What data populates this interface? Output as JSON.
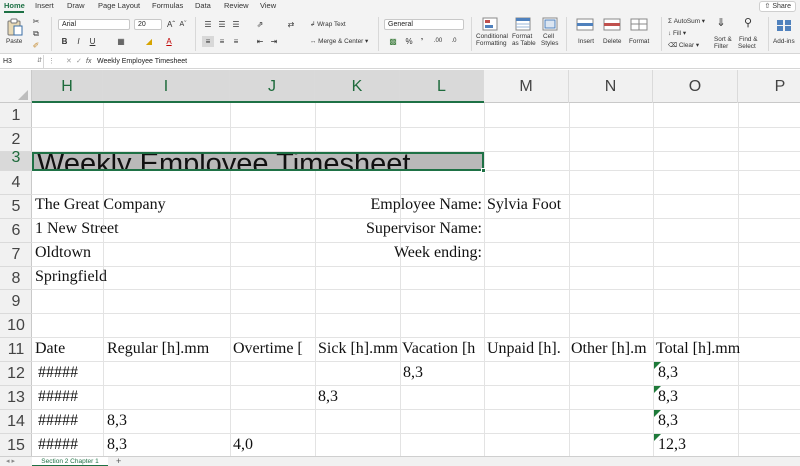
{
  "ribbon_tabs": [
    "Home",
    "Insert",
    "Draw",
    "Page Layout",
    "Formulas",
    "Data",
    "Review",
    "View"
  ],
  "share_label": "Share",
  "ribbon": {
    "paste_label": "Paste",
    "font_name": "Arial",
    "font_size": "20",
    "bold": "B",
    "italic": "I",
    "underline": "U",
    "wrap_text": "Wrap Text",
    "merge_center": "Merge & Center",
    "number_format": "General",
    "percent": "%",
    "comma": "’",
    "conditional_formatting": [
      "Conditional",
      "Formatting"
    ],
    "format_as_table": [
      "Format",
      "as Table"
    ],
    "cell_styles": [
      "Cell",
      "Styles"
    ],
    "insert": "Insert",
    "delete": "Delete",
    "format": "Format",
    "autosum": "AutoSum",
    "fill": "Fill",
    "clear": "Clear",
    "sort_filter": [
      "Sort &",
      "Filter"
    ],
    "find_select": [
      "Find &",
      "Select"
    ],
    "add_ins": "Add-ins"
  },
  "formula_bar": {
    "cell_ref": "H3",
    "fx": "fx",
    "content": "Weekly Employee Timesheet"
  },
  "columns": [
    "H",
    "I",
    "J",
    "K",
    "L",
    "M",
    "N",
    "O",
    "P"
  ],
  "rows": [
    "1",
    "2",
    "3",
    "4",
    "5",
    "6",
    "7",
    "8",
    "9",
    "10",
    "11",
    "12",
    "13",
    "14",
    "15"
  ],
  "sheet": {
    "title": "Weekly Employee Timesheet",
    "company": [
      "The Great Company",
      "1 New Street",
      "Oldtown",
      "Springfield"
    ],
    "labels": {
      "employee_name": "Employee Name:",
      "supervisor_name": "Supervisor Name:",
      "week_ending": "Week ending:"
    },
    "employee_name_value": "Sylvia Foot",
    "headers": [
      "Date",
      "Regular [h].mm",
      "Overtime [",
      "Sick [h].mm",
      "Vacation [h",
      "Unpaid [h].",
      "Other [h].m",
      "Total [h].mm"
    ],
    "data_rows": [
      {
        "date": "#####",
        "regular": "",
        "overtime": "",
        "sick": "",
        "vacation": "8,3",
        "unpaid": "",
        "other": "",
        "total": "8,3"
      },
      {
        "date": "#####",
        "regular": "",
        "overtime": "",
        "sick": "8,3",
        "vacation": "",
        "unpaid": "",
        "other": "",
        "total": "8,3"
      },
      {
        "date": "#####",
        "regular": "8,3",
        "overtime": "",
        "sick": "",
        "vacation": "",
        "unpaid": "",
        "other": "",
        "total": "8,3"
      },
      {
        "date": "#####",
        "regular": "8,3",
        "overtime": "4,0",
        "sick": "",
        "vacation": "",
        "unpaid": "",
        "other": "",
        "total": "12,3"
      }
    ]
  },
  "sheet_tab": "Section 2 Chapter 1",
  "add_sheet": "+",
  "colors": {
    "accent": "#1e7145",
    "selected_fill": "#b9b9b9",
    "header_bg": "#f1f1f1"
  }
}
